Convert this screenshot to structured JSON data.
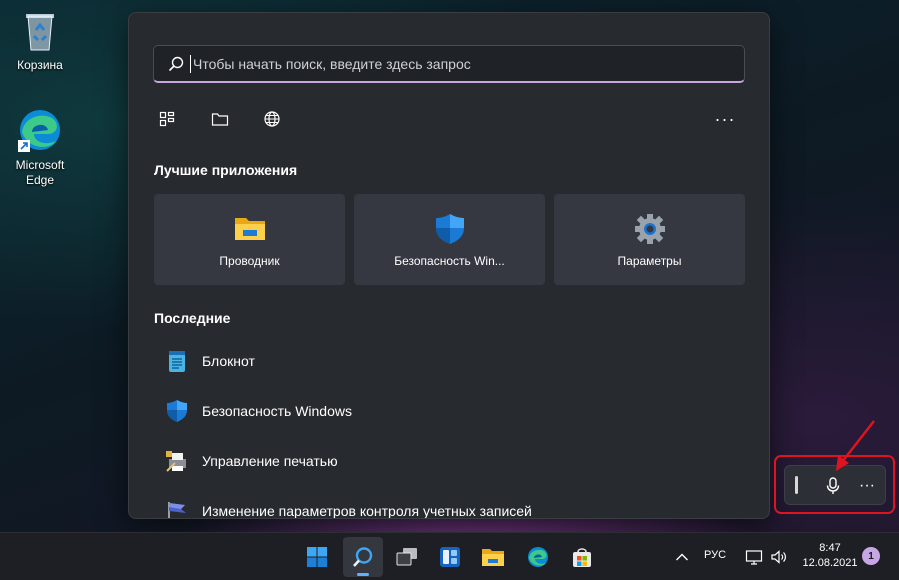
{
  "desktop": {
    "icons": [
      {
        "label": "Корзина",
        "icon": "recycle-bin-icon"
      },
      {
        "label": "Microsoft Edge",
        "icon": "edge-icon"
      }
    ]
  },
  "search": {
    "placeholder": "Чтобы начать поиск, введите здесь запрос",
    "filters": [
      "apps-filter-icon",
      "documents-filter-icon",
      "web-filter-icon"
    ],
    "more_label": "···"
  },
  "top_apps": {
    "title": "Лучшие приложения",
    "items": [
      {
        "label": "Проводник",
        "icon": "file-explorer-icon"
      },
      {
        "label": "Безопасность Win...",
        "icon": "windows-security-icon"
      },
      {
        "label": "Параметры",
        "icon": "settings-icon"
      }
    ]
  },
  "recent": {
    "title": "Последние",
    "items": [
      {
        "label": "Блокнот",
        "icon": "notepad-icon"
      },
      {
        "label": "Безопасность Windows",
        "icon": "windows-security-icon"
      },
      {
        "label": "Управление печатью",
        "icon": "print-management-icon"
      },
      {
        "label": "Изменение параметров контроля учетных записей",
        "icon": "uac-flag-icon"
      }
    ]
  },
  "voice_typing": {
    "more_label": "···"
  },
  "taskbar": {
    "apps": [
      "windows-start-icon",
      "search-icon",
      "task-view-icon",
      "widgets-icon",
      "file-explorer-icon",
      "edge-icon",
      "store-icon"
    ],
    "language": "РУС",
    "time": "8:47",
    "date": "12.08.2021",
    "notification_count": "1"
  },
  "colors": {
    "accent": "#5fb2ff",
    "highlight": "#e0141f",
    "search_underline": "#c8a7e0"
  }
}
